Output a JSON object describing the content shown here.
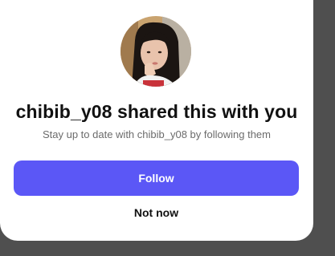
{
  "colors": {
    "backdrop": "#4f4f4f",
    "modal_bg": "#ffffff",
    "accent": "#5b57f6",
    "title": "#111111",
    "subtitle": "#6b6b6b"
  },
  "dialog": {
    "avatar_icon": "profile-photo",
    "title": "chibib_y08 shared this with you",
    "subtitle": "Stay up to date with chibib_y08 by following them",
    "follow_label": "Follow",
    "not_now_label": "Not now"
  }
}
